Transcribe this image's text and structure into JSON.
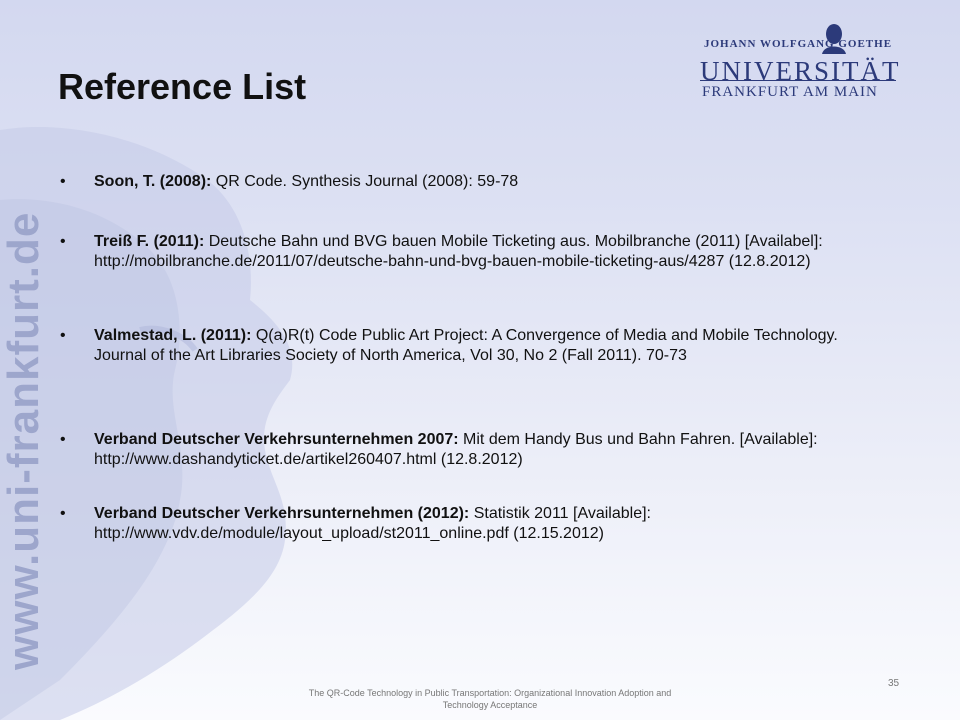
{
  "slide": {
    "title": "Reference List",
    "side_url": "www.uni-frankfurt.de",
    "page_number": "35",
    "footer": "The QR-Code Technology in Public Transportation: Organizational Innovation Adoption and Technology Acceptance"
  },
  "logo": {
    "top_line": "JOHANN WOLFGANG GOETHE",
    "name": "UNIVERSITÄT",
    "city": "FRANKFURT AM MAIN"
  },
  "references": [
    {
      "author": "Soon, T. (2008):",
      "text": " QR Code. Synthesis Journal (2008): 59-78"
    },
    {
      "author": "Treiß F. (2011):",
      "text": " Deutsche Bahn und BVG bauen Mobile Ticketing aus. Mobilbranche (2011) [Availabel]: http://mobilbranche.de/2011/07/deutsche-bahn-und-bvg-bauen-mobile-ticketing-aus/4287 (12.8.2012)"
    },
    {
      "author": "Valmestad, L. (2011):",
      "text": " Q(a)R(t) Code Public Art Project: A Convergence of Media and Mobile Technology. Journal of the Art Libraries Society of North America, Vol 30, No 2 (Fall 2011). 70-73"
    },
    {
      "author": "Verband Deutscher Verkehrsunternehmen 2007:",
      "text": " Mit dem Handy Bus und Bahn Fahren. [Available]: http://www.dashandyticket.de/artikel260407.html (12.8.2012)"
    },
    {
      "author": "Verband Deutscher Verkehrsunternehmen (2012):",
      "text": " Statistik 2011 [Available]: http://www.vdv.de/module/layout_upload/st2011_online.pdf (12.15.2012)"
    }
  ]
}
